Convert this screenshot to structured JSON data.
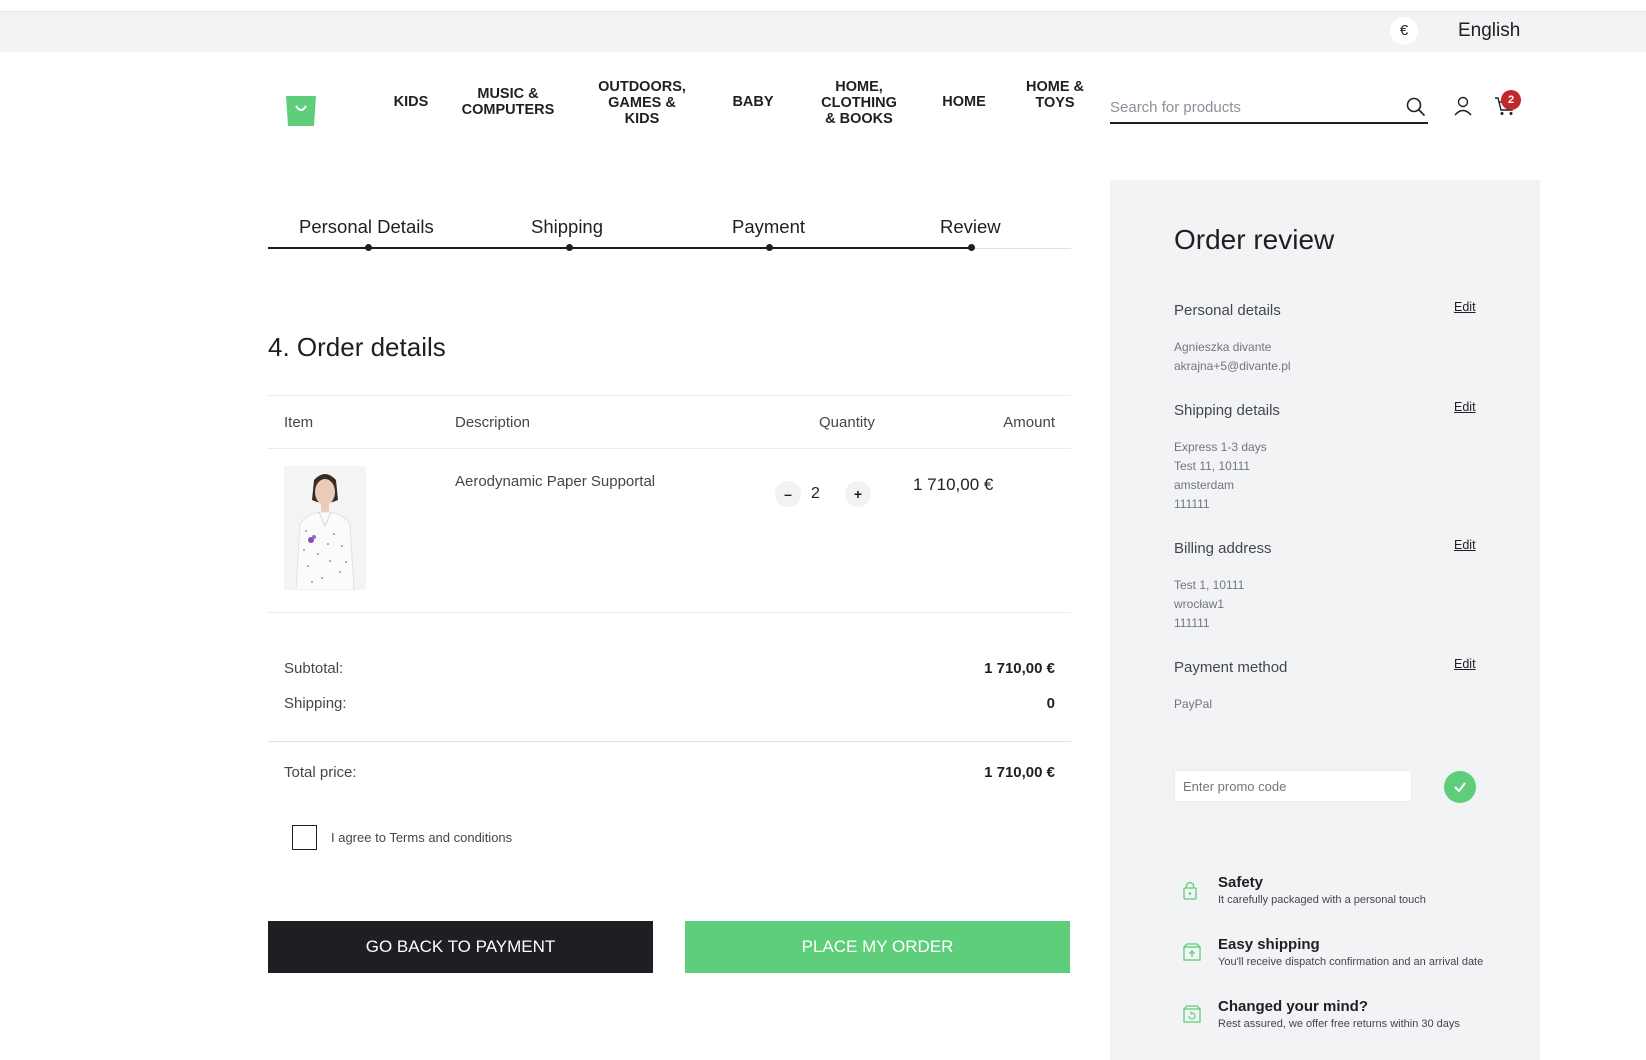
{
  "topbar": {
    "currency": "€",
    "language": "English"
  },
  "header": {
    "nav": [
      "KIDS",
      "MUSIC & COMPUTERS",
      "OUTDOORS, GAMES & KIDS",
      "BABY",
      "HOME, CLOTHING & BOOKS",
      "HOME",
      "HOME & TOYS"
    ],
    "search_placeholder": "Search for products",
    "cart_count": "2"
  },
  "steps": [
    "Personal Details",
    "Shipping",
    "Payment",
    "Review"
  ],
  "order": {
    "title": "4. Order details",
    "columns": {
      "item": "Item",
      "description": "Description",
      "quantity": "Quantity",
      "amount": "Amount"
    },
    "rows": [
      {
        "description": "Aerodynamic Paper Supportal",
        "quantity": "2",
        "amount": "1 710,00 €"
      }
    ],
    "qty_minus": "–",
    "qty_plus": "+",
    "subtotal_label": "Subtotal:",
    "subtotal": "1 710,00 €",
    "shipping_label": "Shipping:",
    "shipping": "0",
    "total_label": "Total price:",
    "total": "1 710,00 €",
    "agree_prefix": "I agree to ",
    "agree_link": "Terms and conditions"
  },
  "actions": {
    "back": "GO BACK TO PAYMENT",
    "place": "PLACE MY ORDER"
  },
  "review": {
    "title": "Order review",
    "edit_label": "Edit",
    "personal": {
      "title": "Personal details",
      "lines": [
        "Agnieszka divante",
        "akrajna+5@divante.pl"
      ]
    },
    "shipping": {
      "title": "Shipping details",
      "lines": [
        "Express 1-3 days",
        "Test 11, 10111",
        "amsterdam",
        "111111"
      ]
    },
    "billing": {
      "title": "Billing address",
      "lines": [
        "Test 1, 10111",
        "wrocław1",
        "111111"
      ]
    },
    "payment": {
      "title": "Payment method",
      "lines": [
        "PayPal"
      ]
    },
    "promo_placeholder": "Enter promo code"
  },
  "features": [
    {
      "title": "Safety",
      "desc": "It carefully packaged with a personal touch",
      "icon": "lock-icon"
    },
    {
      "title": "Easy shipping",
      "desc": "You'll receive dispatch confirmation and an arrival date",
      "icon": "box-icon"
    },
    {
      "title": "Changed your mind?",
      "desc": "Rest assured, we offer free returns within 30 days",
      "icon": "return-box-icon"
    }
  ],
  "colors": {
    "accent": "#5ece7b",
    "dark": "#1d1f22",
    "badge": "#c0282b",
    "sidebar_bg": "#f2f3f4"
  }
}
